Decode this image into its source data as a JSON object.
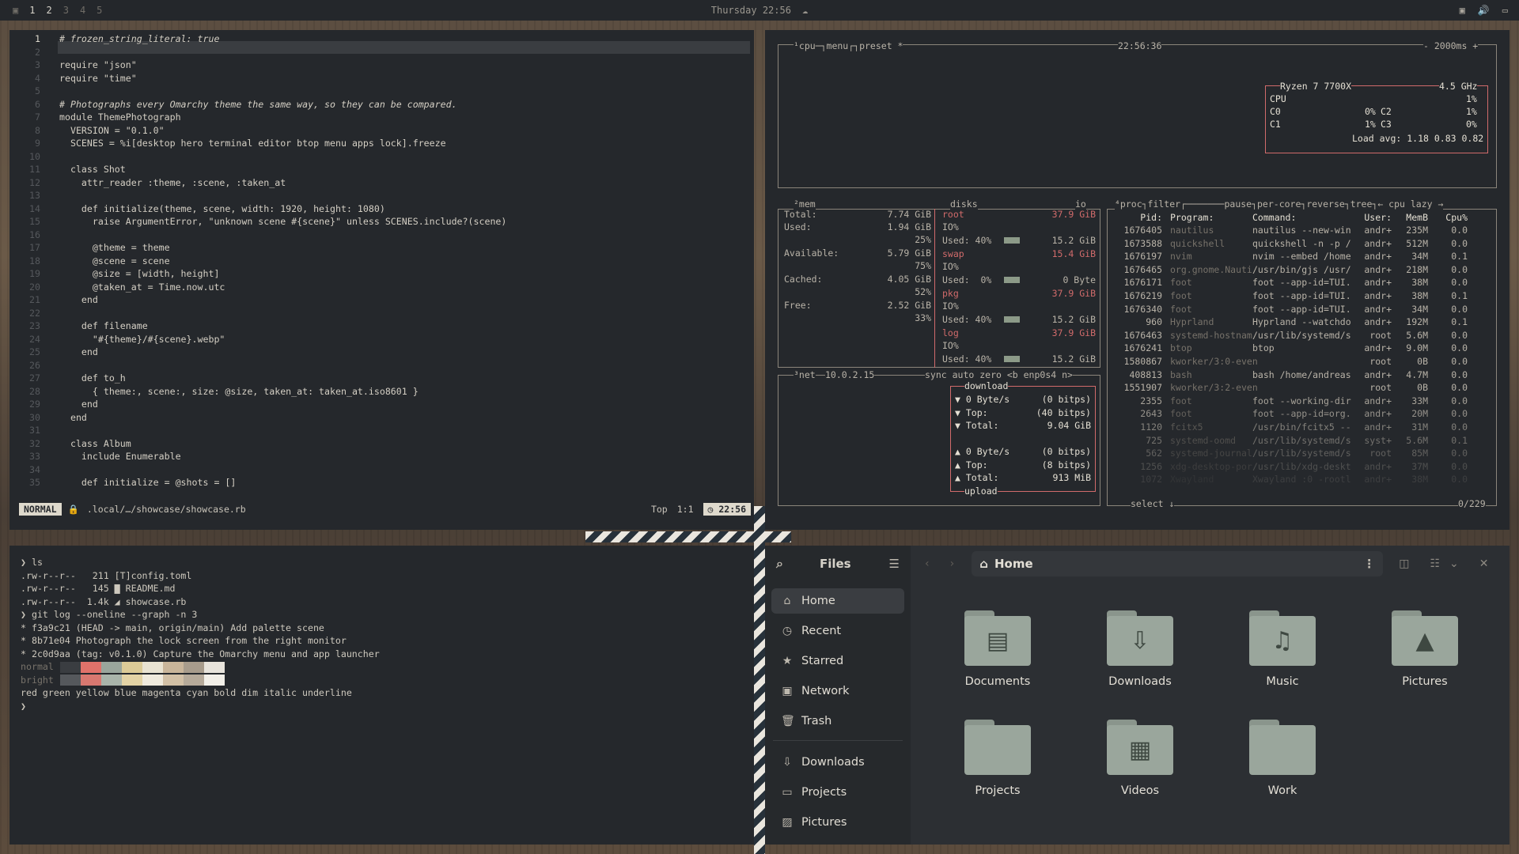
{
  "topbar": {
    "workspaces": [
      "1",
      "2",
      "3",
      "4",
      "5"
    ],
    "clock": "Thursday 22:56"
  },
  "editor": {
    "lines": [
      {
        "n": "1",
        "text": "# frozen_string_literal: true"
      },
      {
        "n": "2",
        "text": ""
      },
      {
        "n": "3",
        "text": "require \"json\""
      },
      {
        "n": "4",
        "text": "require \"time\""
      },
      {
        "n": "5",
        "text": ""
      },
      {
        "n": "6",
        "text": "# Photographs every Omarchy theme the same way, so they can be compared."
      },
      {
        "n": "7",
        "text": "module ThemePhotograph"
      },
      {
        "n": "8",
        "text": "  VERSION = \"0.1.0\""
      },
      {
        "n": "9",
        "text": "  SCENES = %i[desktop hero terminal editor btop menu apps lock].freeze"
      },
      {
        "n": "10",
        "text": ""
      },
      {
        "n": "11",
        "text": "  class Shot"
      },
      {
        "n": "12",
        "text": "    attr_reader :theme, :scene, :taken_at"
      },
      {
        "n": "13",
        "text": ""
      },
      {
        "n": "14",
        "text": "    def initialize(theme, scene, width: 1920, height: 1080)"
      },
      {
        "n": "15",
        "text": "      raise ArgumentError, \"unknown scene #{scene}\" unless SCENES.include?(scene)"
      },
      {
        "n": "16",
        "text": ""
      },
      {
        "n": "17",
        "text": "      @theme = theme"
      },
      {
        "n": "18",
        "text": "      @scene = scene"
      },
      {
        "n": "19",
        "text": "      @size = [width, height]"
      },
      {
        "n": "20",
        "text": "      @taken_at = Time.now.utc"
      },
      {
        "n": "21",
        "text": "    end"
      },
      {
        "n": "22",
        "text": ""
      },
      {
        "n": "23",
        "text": "    def filename"
      },
      {
        "n": "24",
        "text": "      \"#{theme}/#{scene}.webp\""
      },
      {
        "n": "25",
        "text": "    end"
      },
      {
        "n": "26",
        "text": ""
      },
      {
        "n": "27",
        "text": "    def to_h"
      },
      {
        "n": "28",
        "text": "      { theme:, scene:, size: @size, taken_at: taken_at.iso8601 }"
      },
      {
        "n": "29",
        "text": "    end"
      },
      {
        "n": "30",
        "text": "  end"
      },
      {
        "n": "31",
        "text": ""
      },
      {
        "n": "32",
        "text": "  class Album"
      },
      {
        "n": "33",
        "text": "    include Enumerable"
      },
      {
        "n": "34",
        "text": ""
      },
      {
        "n": "35",
        "text": "    def initialize = @shots = []"
      }
    ],
    "status": {
      "mode": "NORMAL",
      "path": ".local/…/showcase/showcase.rb",
      "position": "Top",
      "cursor": "1:1",
      "time": "22:56"
    }
  },
  "btop": {
    "cpu_header": {
      "tabs": "¹cpu─┐menu┌┐preset *",
      "time": "22:56:36",
      "interval": "- 2000ms +"
    },
    "cpu_box": {
      "model": "Ryzen 7 7700X",
      "freq": "4.5 GHz",
      "rows": [
        {
          "label": "CPU",
          "value": "1%"
        },
        {
          "label": "C0",
          "value": "0%",
          "label2": "C2",
          "value2": "1%"
        },
        {
          "label": "C1",
          "value": "1%",
          "label2": "C3",
          "value2": "0%"
        }
      ],
      "load": "Load avg: 1.18 0.83 0.82"
    },
    "mem": {
      "title": "²mem",
      "rows": [
        {
          "label": "Total:",
          "value": "7.74 GiB"
        },
        {
          "label": "Used:",
          "value": "1.94 GiB",
          "pct": "25%"
        },
        {
          "label": "Available:",
          "value": "5.79 GiB",
          "pct": "75%"
        },
        {
          "label": "Cached:",
          "value": "4.05 GiB",
          "pct": "52%"
        },
        {
          "label": "Free:",
          "value": "2.52 GiB",
          "pct": "33%"
        }
      ]
    },
    "disks": {
      "title": "disks",
      "io": "io",
      "rows": [
        {
          "name": "root",
          "size": "37.9 GiB",
          "used_label": "Used: 40%",
          "used": "15.2 GiB"
        },
        {
          "name": "swap",
          "size": "15.4 GiB",
          "used_label": "Used:  0%",
          "used": "0 Byte"
        },
        {
          "name": "pkg",
          "size": "37.9 GiB",
          "used_label": "Used: 40%",
          "used": "15.2 GiB"
        },
        {
          "name": "log",
          "size": "37.9 GiB",
          "used_label": "Used: 40%",
          "used": "15.2 GiB"
        }
      ]
    },
    "net": {
      "title": "³net",
      "ip": "10.0.2.15",
      "controls": "sync auto zero <b enp0s4 n>",
      "download_title": "download",
      "upload_title": "upload",
      "download": [
        {
          "label": "▼ 0 Byte/s",
          "value": "(0 bitps)"
        },
        {
          "label": "▼ Top:",
          "value": "(40 bitps)"
        },
        {
          "label": "▼ Total:",
          "value": "9.04 GiB"
        }
      ],
      "upload": [
        {
          "label": "▲ 0 Byte/s",
          "value": "(0 bitps)"
        },
        {
          "label": "▲ Top:",
          "value": "(8 bitps)"
        },
        {
          "label": "▲ Total:",
          "value": "913 MiB"
        }
      ]
    },
    "proc": {
      "header": "⁴proc┐filter┌───────pause┐per-core┐reverse┐tree┐← cpu lazy →",
      "columns": {
        "pid": "Pid:",
        "program": "Program:",
        "command": "Command:",
        "user": "User:",
        "mem": "MemB",
        "cpu": "Cpu%"
      },
      "rows": [
        {
          "pid": "1676405",
          "program": "nautilus",
          "command": "nautilus --new-win",
          "user": "andr+",
          "mem": "235M",
          "cpu": "0.0"
        },
        {
          "pid": "1673588",
          "program": "quickshell",
          "command": "quickshell -n -p /",
          "user": "andr+",
          "mem": "512M",
          "cpu": "0.0"
        },
        {
          "pid": "1676197",
          "program": "nvim",
          "command": "nvim --embed /home",
          "user": "andr+",
          "mem": "34M",
          "cpu": "0.1"
        },
        {
          "pid": "1676465",
          "program": "org.gnome.Nauti",
          "command": "/usr/bin/gjs /usr/",
          "user": "andr+",
          "mem": "218M",
          "cpu": "0.0"
        },
        {
          "pid": "1676171",
          "program": "foot",
          "command": "foot --app-id=TUI.",
          "user": "andr+",
          "mem": "38M",
          "cpu": "0.0"
        },
        {
          "pid": "1676219",
          "program": "foot",
          "command": "foot --app-id=TUI.",
          "user": "andr+",
          "mem": "38M",
          "cpu": "0.1"
        },
        {
          "pid": "1676340",
          "program": "foot",
          "command": "foot --app-id=TUI.",
          "user": "andr+",
          "mem": "34M",
          "cpu": "0.0"
        },
        {
          "pid": "960",
          "program": "Hyprland",
          "command": "Hyprland --watchdo",
          "user": "andr+",
          "mem": "192M",
          "cpu": "0.1"
        },
        {
          "pid": "1676463",
          "program": "systemd-hostnam",
          "command": "/usr/lib/systemd/s",
          "user": "root",
          "mem": "5.6M",
          "cpu": "0.0"
        },
        {
          "pid": "1676241",
          "program": "btop",
          "command": "btop",
          "user": "andr+",
          "mem": "9.0M",
          "cpu": "0.0"
        },
        {
          "pid": "1580867",
          "program": "kworker/3:0-even",
          "command": "",
          "user": "root",
          "mem": "0B",
          "cpu": "0.0"
        },
        {
          "pid": "408813",
          "program": "bash",
          "command": "bash /home/andreas",
          "user": "andr+",
          "mem": "4.7M",
          "cpu": "0.0"
        },
        {
          "pid": "1551907",
          "program": "kworker/3:2-even",
          "command": "",
          "user": "root",
          "mem": "0B",
          "cpu": "0.0"
        },
        {
          "pid": "2355",
          "program": "foot",
          "command": "foot --working-dir",
          "user": "andr+",
          "mem": "33M",
          "cpu": "0.0"
        },
        {
          "pid": "2643",
          "program": "foot",
          "command": "foot --app-id=org.",
          "user": "andr+",
          "mem": "20M",
          "cpu": "0.0"
        },
        {
          "pid": "1120",
          "program": "fcitx5",
          "command": "/usr/bin/fcitx5 --",
          "user": "andr+",
          "mem": "31M",
          "cpu": "0.0"
        },
        {
          "pid": "725",
          "program": "systemd-oomd",
          "command": "/usr/lib/systemd/s",
          "user": "syst+",
          "mem": "5.6M",
          "cpu": "0.1"
        },
        {
          "pid": "562",
          "program": "systemd-journal",
          "command": "/usr/lib/systemd/s",
          "user": "root",
          "mem": "85M",
          "cpu": "0.0"
        },
        {
          "pid": "1256",
          "program": "xdg-desktop-por",
          "command": "/usr/lib/xdg-deskt",
          "user": "andr+",
          "mem": "37M",
          "cpu": "0.0"
        },
        {
          "pid": "1072",
          "program": "Xwayland",
          "command": "Xwayland :0 -rootl",
          "user": "andr+",
          "mem": "38M",
          "cpu": "0.0"
        }
      ],
      "footer_select": "select ↓",
      "footer_count": "0/229"
    }
  },
  "terminal": {
    "lines": [
      "❯ ls",
      ".rw-r--r--   211 [T]config.toml",
      ".rw-r--r--   145 ▇ README.md",
      ".rw-r--r--  1.4k ◢ showcase.rb",
      "❯ git log --oneline --graph -n 3",
      "* f3a9c21 (HEAD -> main, origin/main) Add palette scene",
      "* 8b71e04 Photograph the lock screen from the right monitor",
      "* 2c0d9aa (tag: v0.1.0) Capture the Omarchy menu and app launcher",
      "normal",
      "bright",
      "red green yellow blue magenta cyan bold dim italic underline",
      "❯"
    ],
    "palette_normal": [
      "#3a3d41",
      "#e0726a",
      "#9aa69c",
      "#dccb97",
      "#e9e3d2",
      "#c9b59a",
      "#a89c8c",
      "#e8e4dc"
    ],
    "palette_bright": [
      "#55585c",
      "#d87870",
      "#a9b4aa",
      "#e3d3a5",
      "#efeadd",
      "#d2c0a6",
      "#b6aa9a",
      "#f2efe8"
    ]
  },
  "files": {
    "app_title": "Files",
    "location": "Home",
    "sidebar": [
      {
        "label": "Home",
        "icon": "home-icon",
        "glyph": "⌂"
      },
      {
        "label": "Recent",
        "icon": "clock-icon",
        "glyph": "◷"
      },
      {
        "label": "Starred",
        "icon": "star-icon",
        "glyph": "★"
      },
      {
        "label": "Network",
        "icon": "network-icon",
        "glyph": "▣"
      },
      {
        "label": "Trash",
        "icon": "trash-icon",
        "glyph": "🗑"
      },
      {
        "label": "Downloads",
        "icon": "download-icon",
        "glyph": "⇩"
      },
      {
        "label": "Projects",
        "icon": "folder-icon",
        "glyph": "▭"
      },
      {
        "label": "Pictures",
        "icon": "image-icon",
        "glyph": "▨"
      }
    ],
    "folders": [
      {
        "label": "Documents",
        "icon": "document-folder-icon",
        "glyph": "▤"
      },
      {
        "label": "Downloads",
        "icon": "download-folder-icon",
        "glyph": "⇩"
      },
      {
        "label": "Music",
        "icon": "music-folder-icon",
        "glyph": "♫"
      },
      {
        "label": "Pictures",
        "icon": "pictures-folder-icon",
        "glyph": "▲"
      },
      {
        "label": "Projects",
        "icon": "projects-folder-icon",
        "glyph": ""
      },
      {
        "label": "Videos",
        "icon": "videos-folder-icon",
        "glyph": "▦"
      },
      {
        "label": "Work",
        "icon": "work-folder-icon",
        "glyph": ""
      }
    ]
  }
}
